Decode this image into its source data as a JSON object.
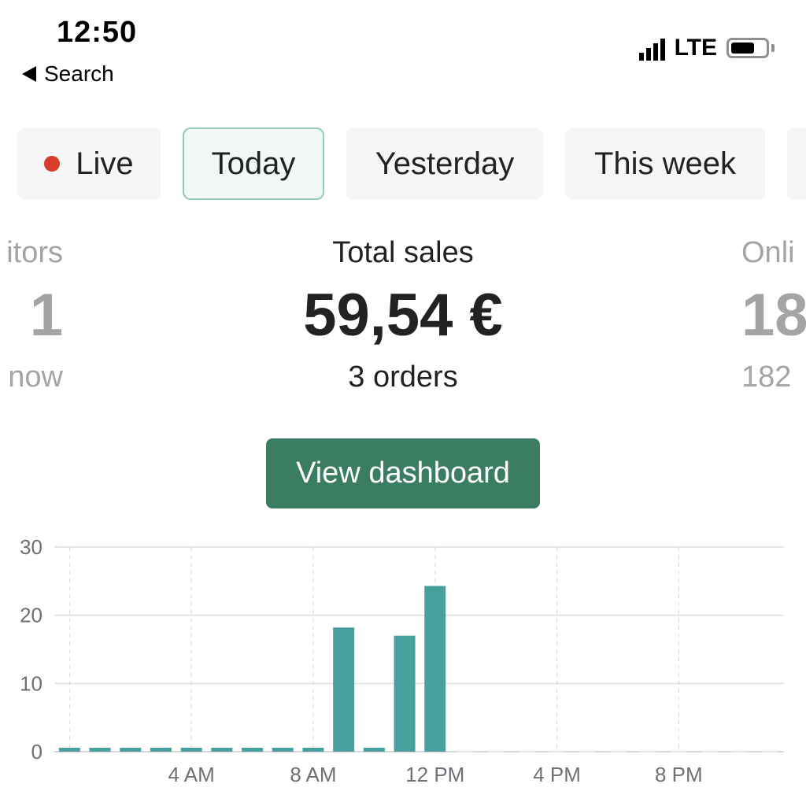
{
  "status": {
    "time": "12:50",
    "back_label": "Search",
    "network": "LTE",
    "battery_level": 0.7
  },
  "filters": {
    "live": "Live",
    "today": "Today",
    "yesterday": "Yesterday",
    "this_week": "This week",
    "selected": "Today"
  },
  "metrics": {
    "left": {
      "label": "itors",
      "value": "1",
      "sub": "now"
    },
    "center": {
      "label": "Total sales",
      "value": "59,54 €",
      "sub": "3 orders"
    },
    "right": {
      "label": "Onli",
      "value": "18",
      "sub": "182"
    }
  },
  "actions": {
    "view_dashboard": "View dashboard"
  },
  "colors": {
    "accent": "#3a7d63",
    "bar": "#47a09d",
    "live_dot": "#d73e2a"
  },
  "chart_data": {
    "type": "bar",
    "categories": [
      "0",
      "1",
      "2",
      "3",
      "4",
      "5",
      "6",
      "7",
      "8",
      "9",
      "10",
      "11",
      "12",
      "13",
      "14",
      "15",
      "16",
      "17",
      "18",
      "19",
      "20",
      "21",
      "22",
      "23"
    ],
    "values": [
      0,
      0,
      0,
      0,
      0,
      0,
      0,
      0,
      0,
      18.2,
      0,
      17,
      24.3,
      0,
      0,
      0,
      0,
      0,
      0,
      0,
      0,
      0,
      0,
      0
    ],
    "x_tick_labels": [
      {
        "hour": 4,
        "label": "4 AM"
      },
      {
        "hour": 8,
        "label": "8 AM"
      },
      {
        "hour": 12,
        "label": "12 PM"
      },
      {
        "hour": 16,
        "label": "4 PM"
      },
      {
        "hour": 20,
        "label": "8 PM"
      }
    ],
    "y_ticks": [
      "0",
      "10",
      "20",
      "30"
    ],
    "ylim": [
      0,
      30
    ],
    "current_hour": 12,
    "grid": true,
    "title": "",
    "xlabel": "",
    "ylabel": ""
  }
}
